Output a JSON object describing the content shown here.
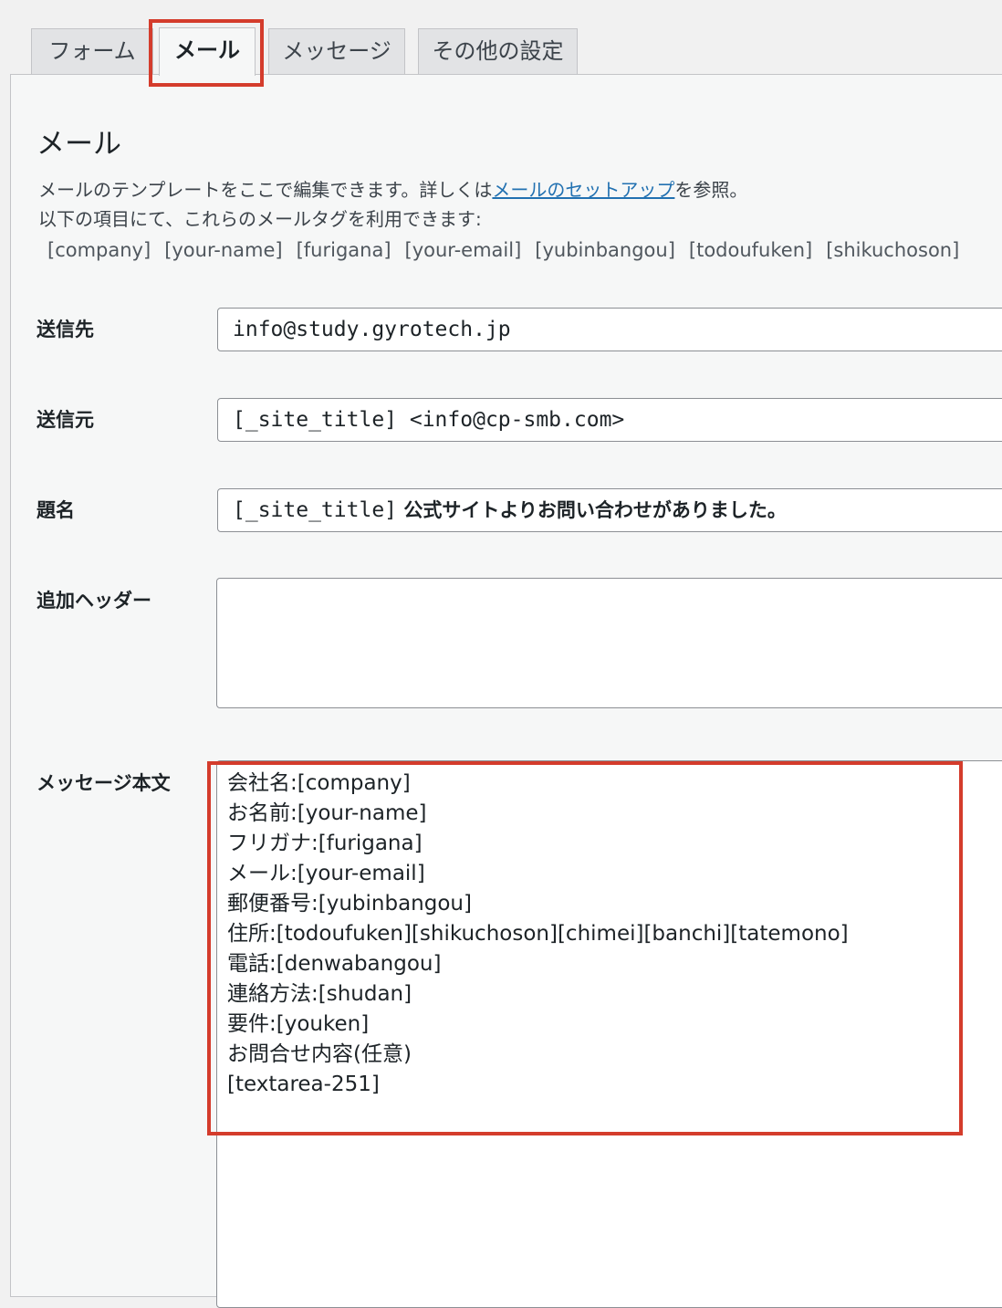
{
  "tabs": [
    {
      "label": "フォーム"
    },
    {
      "label": "メール"
    },
    {
      "label": "メッセージ"
    },
    {
      "label": "その他の設定"
    }
  ],
  "active_tab": "メール",
  "heading": "メール",
  "description": {
    "line1_before": "メールのテンプレートをここで編集できます。詳しくは",
    "line1_link": "メールのセットアップ",
    "line1_after": "を参照。",
    "line2": "以下の項目にて、これらのメールタグを利用できます:"
  },
  "mail_tags": [
    "[company]",
    "[your-name]",
    "[furigana]",
    "[your-email]",
    "[yubinbangou]",
    "[todoufuken]",
    "[shikuchoson]"
  ],
  "fields": {
    "to": {
      "label": "送信先",
      "value": "info@study.gyrotech.jp"
    },
    "from": {
      "label": "送信元",
      "value": "[_site_title] <info@cp-smb.com>"
    },
    "subject": {
      "label": "題名",
      "value_tag": "[_site_title]",
      "value_text": " 公式サイトよりお問い合わせがありました。"
    },
    "headers": {
      "label": "追加ヘッダー",
      "value": ""
    },
    "body": {
      "label": "メッセージ本文",
      "lines": [
        "会社名:[company]",
        "お名前:[your-name]",
        "フリガナ:[furigana]",
        "メール:[your-email]",
        "郵便番号:[yubinbangou]",
        "住所:[todoufuken][shikuchoson][chimei][banchi][tatemono]",
        "電話:[denwabangou]",
        "連絡方法:[shudan]",
        "要件:[youken]",
        "お問合せ内容(任意)",
        "[textarea-251]"
      ]
    }
  },
  "colors": {
    "highlight": "#d43c2c",
    "link": "#2271b1"
  }
}
